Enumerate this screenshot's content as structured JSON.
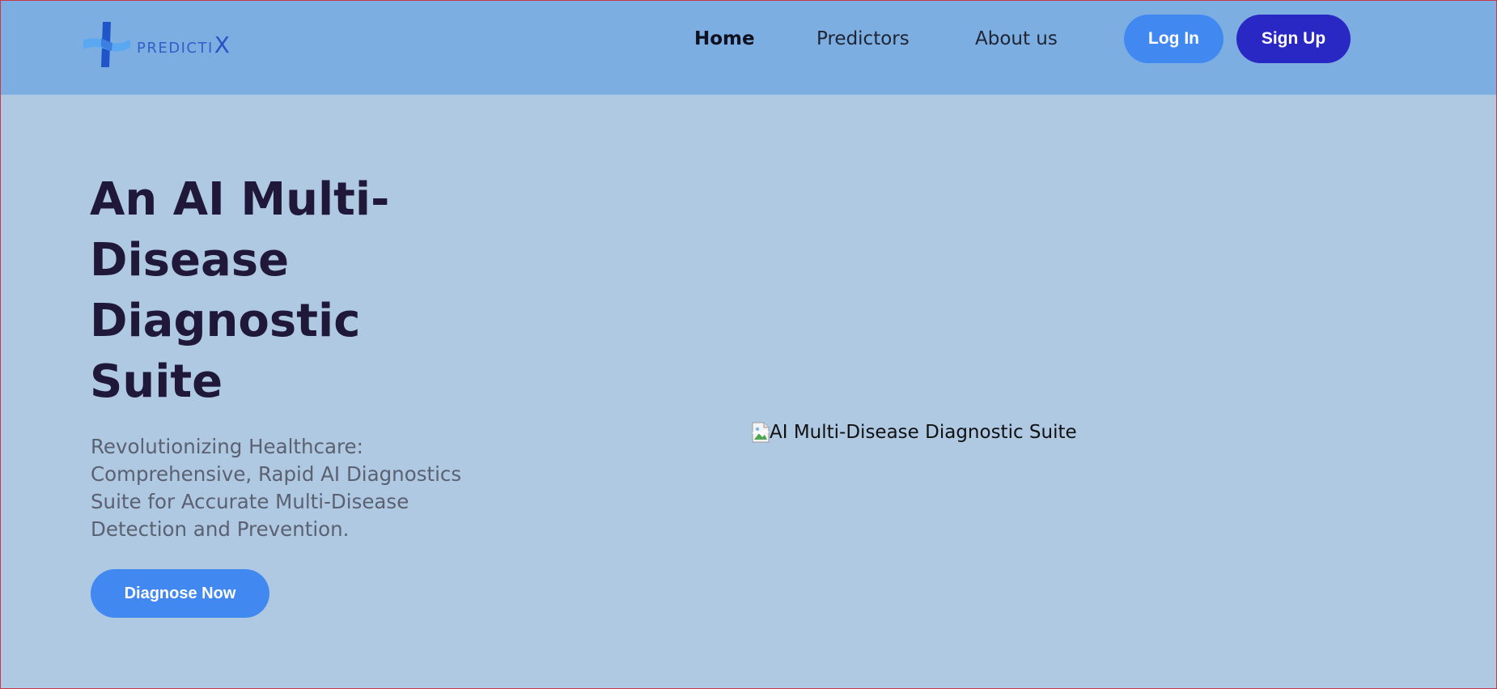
{
  "brand": {
    "name_prefix": "PREDICTI",
    "name_suffix": "X",
    "logo_icon": "medical-cross-logo-icon",
    "colors": {
      "logo_light": "#5aa8f2",
      "logo_dark": "#1f55c9"
    }
  },
  "nav": {
    "links": [
      {
        "label": "Home",
        "active": true
      },
      {
        "label": "Predictors",
        "active": false
      },
      {
        "label": "About us",
        "active": false
      }
    ],
    "login_label": "Log In",
    "signup_label": "Sign Up"
  },
  "hero": {
    "title": "An AI Multi-Disease Diagnostic Suite",
    "subtitle": "Revolutionizing Healthcare: Comprehensive, Rapid AI Diagnostics Suite for Accurate Multi-Disease Detection and Prevention.",
    "cta_label": "Diagnose Now",
    "image_alt": "AI Multi-Disease Diagnostic Suite",
    "image_icon": "broken-image-icon"
  },
  "colors": {
    "navbar_bg": "#7daee2",
    "page_bg": "#afc9e3",
    "primary_button": "#4189f1",
    "secondary_button": "#2a28c4",
    "title_text": "#1f1838"
  }
}
